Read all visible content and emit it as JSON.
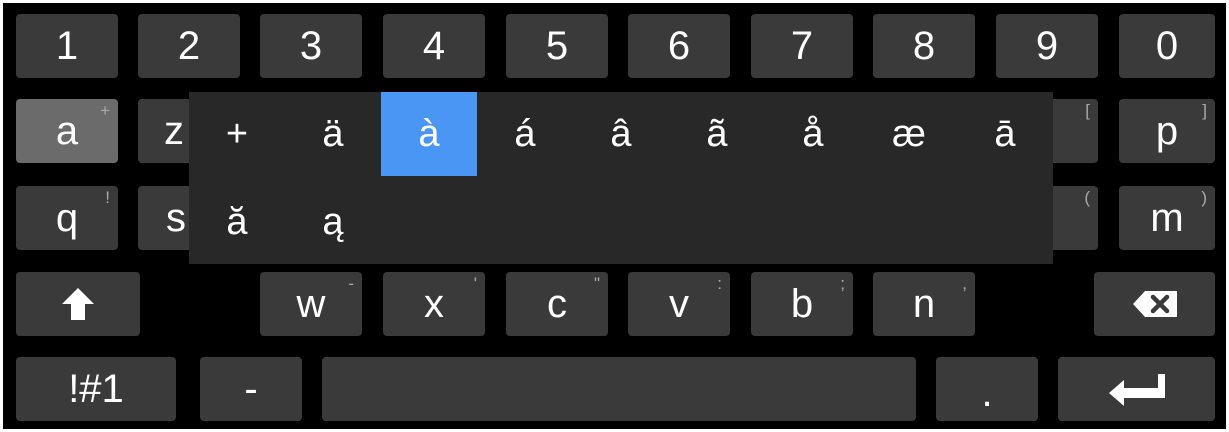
{
  "keyboard": {
    "number_row": [
      "1",
      "2",
      "3",
      "4",
      "5",
      "6",
      "7",
      "8",
      "9",
      "0"
    ],
    "row2": {
      "a": {
        "main": "a",
        "alt": "+"
      },
      "z_partial": {
        "main": "z"
      },
      "o_partial_alt": "[",
      "p": {
        "main": "p",
        "alt": "]"
      }
    },
    "row3": {
      "q": {
        "main": "q",
        "alt": "!"
      },
      "s_partial": {
        "main": "s"
      },
      "l_partial_alt": "(",
      "m": {
        "main": "m",
        "alt": ")"
      }
    },
    "row4": {
      "w": {
        "main": "w",
        "alt": "-"
      },
      "x": {
        "main": "x",
        "alt": "'"
      },
      "c": {
        "main": "c",
        "alt": "\""
      },
      "v": {
        "main": "v",
        "alt": ":"
      },
      "b": {
        "main": "b",
        "alt": ";"
      },
      "n": {
        "main": "n",
        "alt": ","
      }
    },
    "row5": {
      "symbols": "!#1",
      "dash": "-",
      "space": "",
      "period": "."
    },
    "icons": {
      "shift": "shift-up-arrow-icon",
      "backspace": "backspace-icon",
      "enter": "enter-return-icon"
    },
    "colors": {
      "background": "#000000",
      "key": "#3a3a3a",
      "key_highlight": "#6b6b6b",
      "popup": "#282828",
      "selected": "#4a96f5"
    }
  },
  "accent_popup": {
    "row1": [
      "+",
      "ä",
      "à",
      "á",
      "â",
      "ã",
      "å",
      "æ",
      "ā"
    ],
    "row2": [
      "ă",
      "ą"
    ],
    "selected": "à"
  }
}
